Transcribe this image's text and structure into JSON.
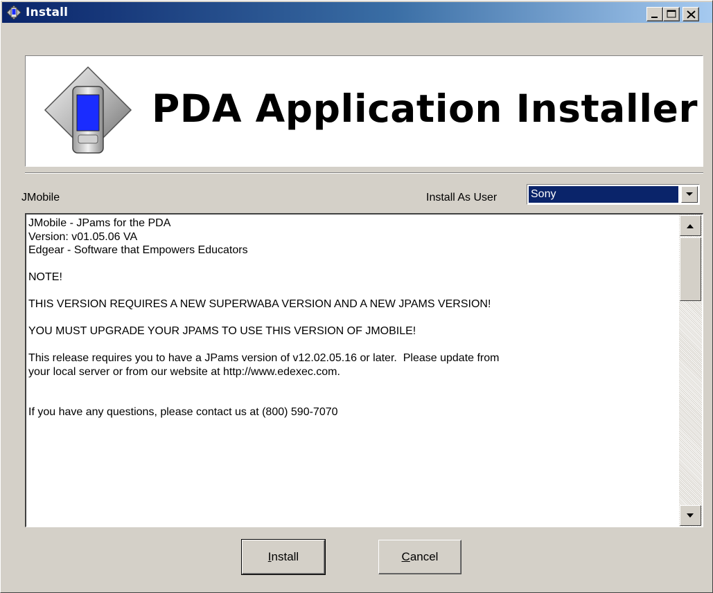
{
  "window": {
    "title": "Install",
    "controls": [
      "minimize",
      "maximize",
      "close"
    ]
  },
  "banner": {
    "title": "PDA Application Installer",
    "logo_icon": "pda-installer-icon"
  },
  "app": {
    "name": "JMobile"
  },
  "user": {
    "label": "Install As User",
    "selected": "Sony"
  },
  "notes": {
    "lines": [
      "JMobile - JPams for the PDA",
      "Version: v01.05.06 VA",
      "Edgear - Software that Empowers Educators",
      "",
      "NOTE!",
      "",
      "THIS VERSION REQUIRES A NEW SUPERWABA VERSION AND A NEW JPAMS VERSION!",
      "",
      "YOU MUST UPGRADE YOUR JPAMS TO USE THIS VERSION OF JMOBILE!",
      "",
      "This release requires you to have a JPams version of v12.02.05.16 or later.  Please update from",
      "your local server or from our website at http://www.edexec.com.",
      "",
      "",
      "If you have any questions, please contact us at (800) 590-7070"
    ]
  },
  "buttons": {
    "install_first": "I",
    "install_rest": "nstall",
    "cancel_first": "C",
    "cancel_rest": "ancel"
  },
  "colors": {
    "titlebar_start": "#0a246a",
    "titlebar_end": "#a6caf0",
    "selection": "#0a246a",
    "face": "#d4d0c8",
    "pda_screen": "#1a2cff"
  }
}
